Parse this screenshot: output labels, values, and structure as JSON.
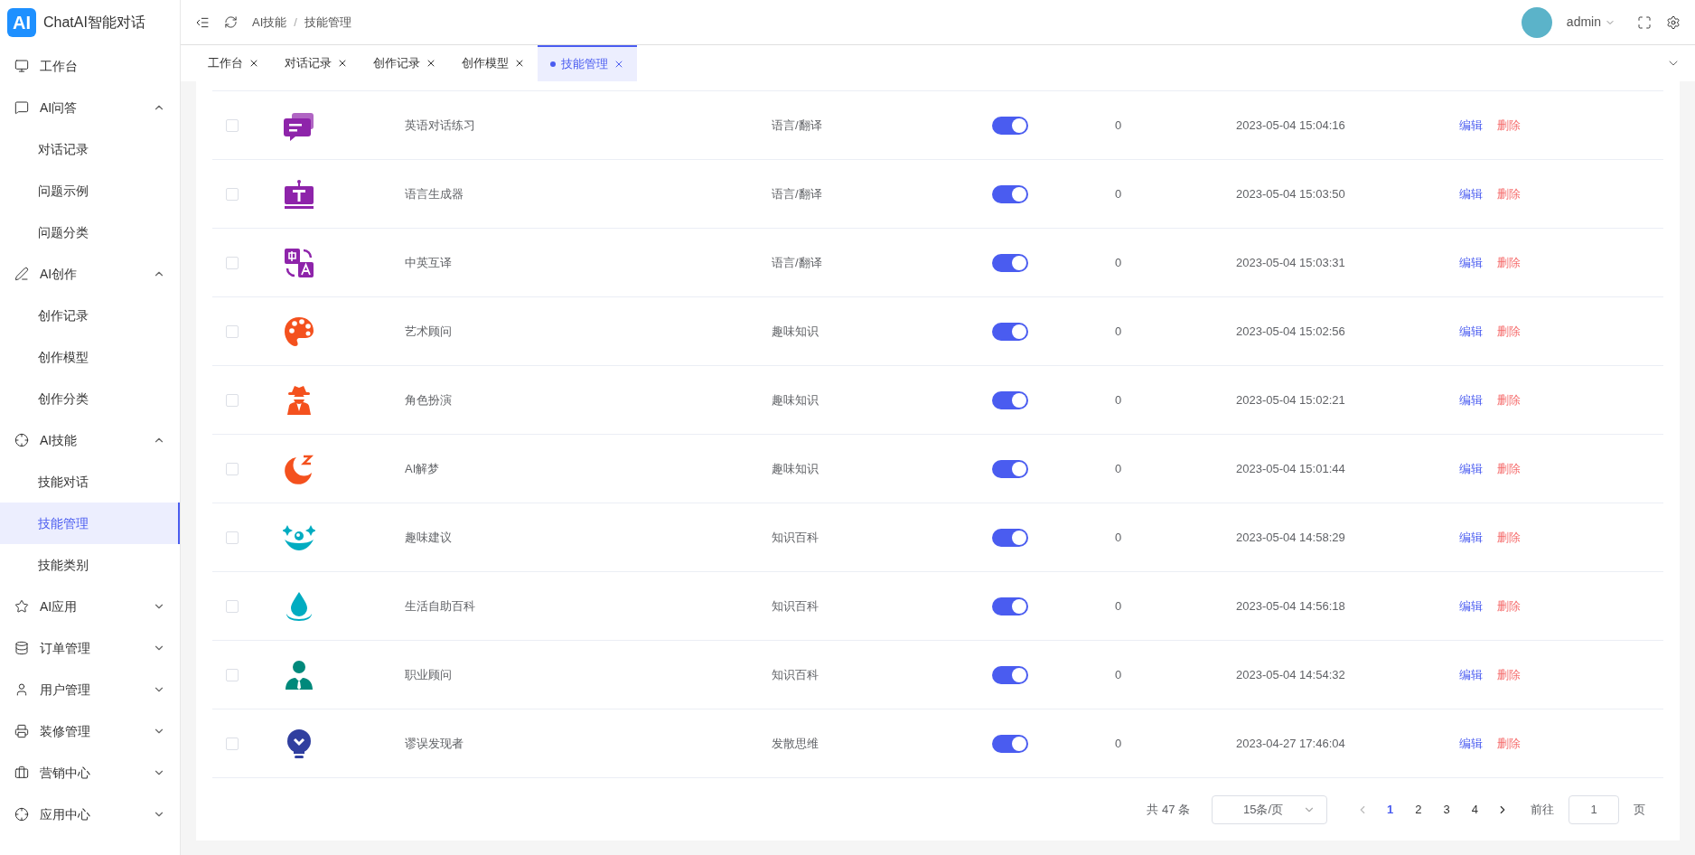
{
  "app": {
    "logo": "AI",
    "title": "ChatAI智能对话"
  },
  "sidebar": {
    "items": [
      {
        "label": "工作台"
      },
      {
        "label": "AI问答",
        "expanded": true,
        "children": [
          {
            "label": "对话记录",
            "selected": false
          },
          {
            "label": "问题示例",
            "selected": false
          },
          {
            "label": "问题分类",
            "selected": false
          }
        ]
      },
      {
        "label": "AI创作",
        "expanded": true,
        "children": [
          {
            "label": "创作记录",
            "selected": false
          },
          {
            "label": "创作模型",
            "selected": false
          },
          {
            "label": "创作分类",
            "selected": false
          }
        ]
      },
      {
        "label": "AI技能",
        "expanded": true,
        "children": [
          {
            "label": "技能对话",
            "selected": false
          },
          {
            "label": "技能管理",
            "selected": true
          },
          {
            "label": "技能类别",
            "selected": false
          }
        ]
      },
      {
        "label": "AI应用",
        "expanded": false
      },
      {
        "label": "订单管理",
        "expanded": false
      },
      {
        "label": "用户管理",
        "expanded": false
      },
      {
        "label": "装修管理",
        "expanded": false
      },
      {
        "label": "营销中心",
        "expanded": false
      },
      {
        "label": "应用中心",
        "expanded": false
      }
    ]
  },
  "breadcrumb": {
    "separator": "/",
    "items": [
      "AI技能",
      "技能管理"
    ]
  },
  "user": {
    "name": "admin"
  },
  "tabs": [
    {
      "label": "工作台",
      "selected": false
    },
    {
      "label": "对话记录",
      "selected": false
    },
    {
      "label": "创作记录",
      "selected": false
    },
    {
      "label": "创作模型",
      "selected": false
    },
    {
      "label": "技能管理",
      "selected": true
    }
  ],
  "table": {
    "rows": [
      {
        "checked": false,
        "name": "英语对话练习",
        "category": "语言/翻译",
        "on": true,
        "count": "0",
        "time": "2023-05-04 15:04:16",
        "actions": [
          "编辑",
          "删除"
        ]
      },
      {
        "checked": false,
        "name": "语言生成器",
        "category": "语言/翻译",
        "on": true,
        "count": "0",
        "time": "2023-05-04 15:03:50",
        "actions": [
          "编辑",
          "删除"
        ]
      },
      {
        "checked": false,
        "name": "中英互译",
        "category": "语言/翻译",
        "on": true,
        "count": "0",
        "time": "2023-05-04 15:03:31",
        "actions": [
          "编辑",
          "删除"
        ]
      },
      {
        "checked": false,
        "name": "艺术顾问",
        "category": "趣味知识",
        "on": true,
        "count": "0",
        "time": "2023-05-04 15:02:56",
        "actions": [
          "编辑",
          "删除"
        ]
      },
      {
        "checked": false,
        "name": "角色扮演",
        "category": "趣味知识",
        "on": true,
        "count": "0",
        "time": "2023-05-04 15:02:21",
        "actions": [
          "编辑",
          "删除"
        ]
      },
      {
        "checked": false,
        "name": "AI解梦",
        "category": "趣味知识",
        "on": true,
        "count": "0",
        "time": "2023-05-04 15:01:44",
        "actions": [
          "编辑",
          "删除"
        ]
      },
      {
        "checked": false,
        "name": "趣味建议",
        "category": "知识百科",
        "on": true,
        "count": "0",
        "time": "2023-05-04 14:58:29",
        "actions": [
          "编辑",
          "删除"
        ]
      },
      {
        "checked": false,
        "name": "生活自助百科",
        "category": "知识百科",
        "on": true,
        "count": "0",
        "time": "2023-05-04 14:56:18",
        "actions": [
          "编辑",
          "删除"
        ]
      },
      {
        "checked": false,
        "name": "职业顾问",
        "category": "知识百科",
        "on": true,
        "count": "0",
        "time": "2023-05-04 14:54:32",
        "actions": [
          "编辑",
          "删除"
        ]
      },
      {
        "checked": false,
        "name": "谬误发现者",
        "category": "发散思维",
        "on": true,
        "count": "0",
        "time": "2023-04-27 17:46:04",
        "actions": [
          "编辑",
          "删除"
        ]
      }
    ]
  },
  "pagination": {
    "total": "共 47 条",
    "page_size": "15条/页",
    "pages": [
      {
        "label": "1",
        "selected": true
      },
      {
        "label": "2",
        "selected": false
      },
      {
        "label": "3",
        "selected": false
      },
      {
        "label": "4",
        "selected": false
      }
    ],
    "goto_label": "前往",
    "goto_value": "1",
    "goto_suffix": "页"
  }
}
